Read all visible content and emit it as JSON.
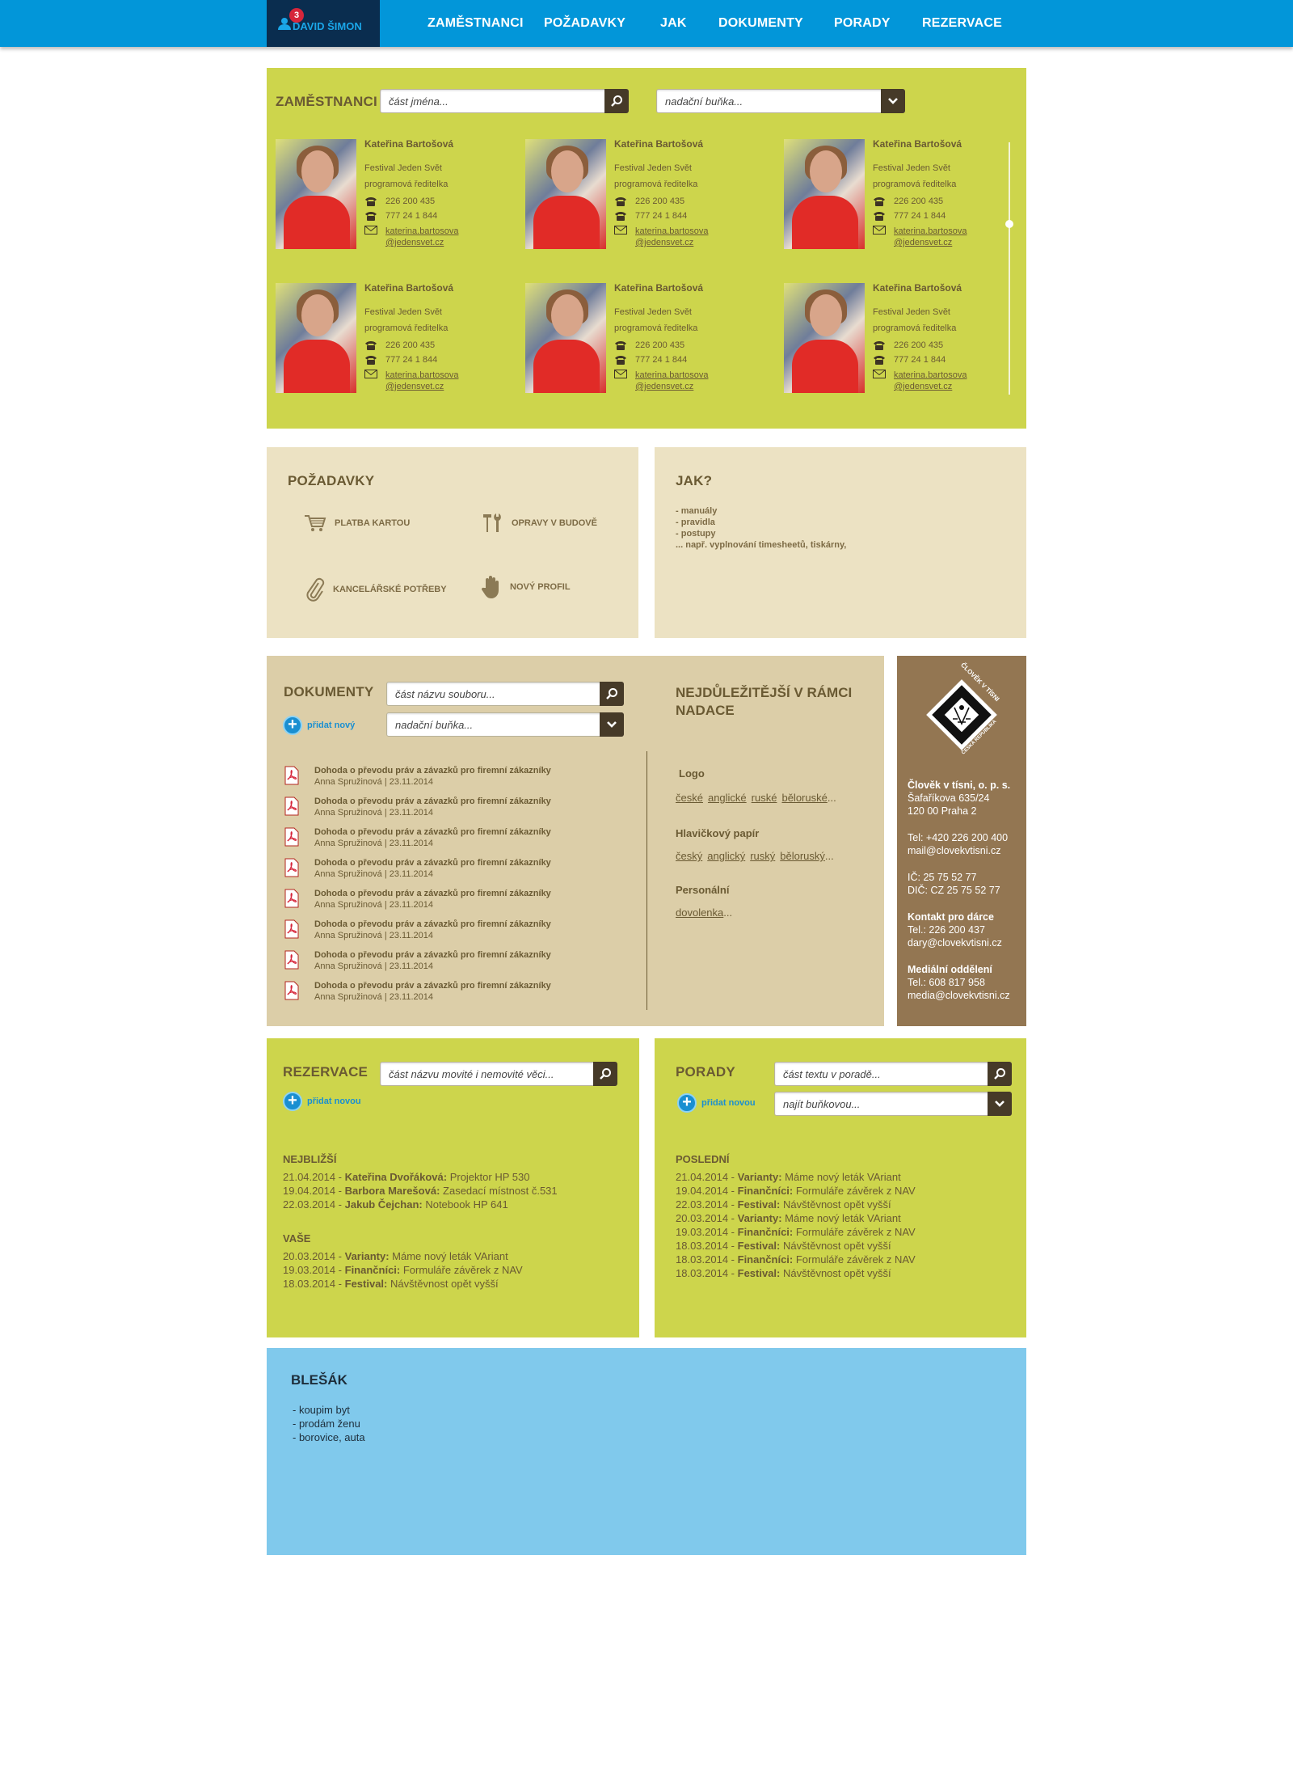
{
  "topbar": {
    "user_name": "DAVID ŠIMON",
    "notification_count": "3",
    "nav": [
      "ZAMĚSTNANCI",
      "POŽADAVKY",
      "JAK",
      "DOKUMENTY",
      "PORADY",
      "REZERVACE"
    ]
  },
  "employees": {
    "title": "ZAMĚSTNANCI",
    "search_placeholder": "část jména...",
    "filter_placeholder": "nadační buňka...",
    "cards": [
      {
        "name": "Kateřina Bartošová",
        "org": "Festival Jeden Svět",
        "role": "programová ředitelka",
        "phone1": "226 200 435",
        "phone2": "777  24 1 844",
        "email1": "katerina.bartosova",
        "email2": "@jedensvet.cz"
      },
      {
        "name": "Kateřina Bartošová",
        "org": "Festival Jeden Svět",
        "role": "programová ředitelka",
        "phone1": "226 200 435",
        "phone2": "777  24 1 844",
        "email1": "katerina.bartosova",
        "email2": "@jedensvet.cz"
      },
      {
        "name": "Kateřina Bartošová",
        "org": "Festival Jeden Svět",
        "role": "programová ředitelka",
        "phone1": "226 200 435",
        "phone2": "777  24 1 844",
        "email1": "katerina.bartosova",
        "email2": "@jedensvet.cz"
      },
      {
        "name": "Kateřina Bartošová",
        "org": "Festival Jeden Svět",
        "role": "programová ředitelka",
        "phone1": "226 200 435",
        "phone2": "777  24 1 844",
        "email1": "katerina.bartosova",
        "email2": "@jedensvet.cz"
      },
      {
        "name": "Kateřina Bartošová",
        "org": "Festival Jeden Svět",
        "role": "programová ředitelka",
        "phone1": "226 200 435",
        "phone2": "777  24 1 844",
        "email1": "katerina.bartosova",
        "email2": "@jedensvet.cz"
      },
      {
        "name": "Kateřina Bartošová",
        "org": "Festival Jeden Svět",
        "role": "programová ředitelka",
        "phone1": "226 200 435",
        "phone2": "777  24 1 844",
        "email1": "katerina.bartosova",
        "email2": "@jedensvet.cz"
      }
    ]
  },
  "requests": {
    "title": "POŽADAVKY",
    "items": [
      "PLATBA KARTOU",
      "OPRAVY V BUDOVĚ",
      "KANCELÁŘSKÉ POTŘEBY",
      "NOVÝ PROFIL"
    ]
  },
  "how": {
    "title": "JAK?",
    "lines": [
      "- manuály",
      "- pravidla",
      "- postupy",
      "... např. vyplnování timesheetů, tiskárny,"
    ]
  },
  "documents": {
    "title": "DOKUMENTY",
    "search_placeholder": "část názvu souboru...",
    "filter_placeholder": "nadační buňka...",
    "add_label": "přidat nový",
    "items": [
      {
        "title": "Dohoda o převodu práv a závazků pro firemní zákazníky",
        "meta": "Anna Spružinová | 23.11.2014"
      },
      {
        "title": "Dohoda o převodu práv a závazků pro firemní zákazníky",
        "meta": "Anna Spružinová | 23.11.2014"
      },
      {
        "title": "Dohoda o převodu práv a závazků pro firemní zákazníky",
        "meta": "Anna Spružinová | 23.11.2014"
      },
      {
        "title": "Dohoda o převodu práv a závazků pro firemní zákazníky",
        "meta": "Anna Spružinová | 23.11.2014"
      },
      {
        "title": "Dohoda o převodu práv a závazků pro firemní zákazníky",
        "meta": "Anna Spružinová | 23.11.2014"
      },
      {
        "title": "Dohoda o převodu práv a závazků pro firemní zákazníky",
        "meta": "Anna Spružinová | 23.11.2014"
      },
      {
        "title": "Dohoda o převodu práv a závazků pro firemní zákazníky",
        "meta": "Anna Spružinová | 23.11.2014"
      },
      {
        "title": "Dohoda o převodu práv a závazků pro firemní zákazníky",
        "meta": "Anna Spružinová | 23.11.2014"
      }
    ],
    "important_title_1": "NEJDŮLEŽITĚJŠÍ V RÁMCI",
    "important_title_2": "NADACE",
    "groups": [
      {
        "label": "Logo",
        "links": [
          "české",
          "anglické",
          "ruské",
          "běloruské"
        ],
        "more": "..."
      },
      {
        "label": "Hlavičkový papír",
        "links": [
          "český",
          "anglický",
          "ruský",
          "běloruský"
        ],
        "more": "..."
      },
      {
        "label": "Personální",
        "links": [
          "dovolenka"
        ],
        "more": "..."
      }
    ]
  },
  "org": {
    "logo_text_top": "ČLOVĚK V TÍSNI",
    "logo_text_bottom": "ČESKÁ REPUBLIKA",
    "name": "Člověk v tísni, o. p. s.",
    "street": "Šafaříkova 635/24",
    "city": "120 00 Praha 2",
    "tel": "Tel: +420 226 200 400",
    "mail": "mail@clovekvtisni.cz",
    "ic": "IČ: 25 75 52 77",
    "dic": "DIČ: CZ 25 75 52 77",
    "donor_title": "Kontakt pro dárce",
    "donor_tel": "Tel.: 226 200 437",
    "donor_mail": "dary@clovekvtisni.cz",
    "media_title": "Mediální oddělení",
    "media_tel": "Tel.: 608 817 958",
    "media_mail": "media@clovekvtisni.cz"
  },
  "reservations": {
    "title": "REZERVACE",
    "search_placeholder": "část názvu movité i nemovité věci...",
    "add_label": "přidat novou",
    "nearest_title": "NEJBLIŽŠÍ",
    "nearest": [
      {
        "date": "21.04.2014 - ",
        "who": "Kateřina Dvořáková:",
        "what": " Projektor HP 530"
      },
      {
        "date": "19.04.2014 - ",
        "who": "Barbora Marešová:",
        "what": " Zasedací místnost č.531"
      },
      {
        "date": "22.03.2014 - ",
        "who": "Jakub Čejchan:",
        "what": " Notebook HP 641"
      }
    ],
    "yours_title": "VAŠE",
    "yours": [
      {
        "date": "20.03.2014 - ",
        "who": "Varianty:",
        "what": " Máme nový leták VAriant"
      },
      {
        "date": "19.03.2014 - ",
        "who": "Finančníci:",
        "what": " Formuláře závěrek z NAV"
      },
      {
        "date": "18.03.2014 - ",
        "who": "Festival:",
        "what": " Návštěvnost opět vyšší"
      }
    ]
  },
  "meetings": {
    "title": "PORADY",
    "search_placeholder": "část textu v poradě...",
    "filter_placeholder": "najít buňkovou...",
    "add_label": "přidat novou",
    "last_title": "POSLEDNÍ",
    "items": [
      {
        "date": "21.04.2014 - ",
        "who": "Varianty:",
        "what": " Máme nový leták VAriant"
      },
      {
        "date": "19.04.2014 - ",
        "who": "Finančníci:",
        "what": " Formuláře závěrek z NAV"
      },
      {
        "date": "22.03.2014 - ",
        "who": "Festival:",
        "what": " Návštěvnost opět vyšší"
      },
      {
        "date": "20.03.2014 - ",
        "who": "Varianty:",
        "what": " Máme nový leták VAriant"
      },
      {
        "date": "19.03.2014 - ",
        "who": "Finančníci:",
        "what": " Formuláře závěrek z NAV"
      },
      {
        "date": "18.03.2014 - ",
        "who": "Festival:",
        "what": " Návštěvnost opět vyšší"
      },
      {
        "date": "18.03.2014 - ",
        "who": "Finančníci:",
        "what": " Formuláře závěrek z NAV"
      },
      {
        "date": "18.03.2014 - ",
        "who": "Festival:",
        "what": " Návštěvnost opět vyšší"
      }
    ]
  },
  "bazaar": {
    "title": "BLEŠÁK",
    "lines": [
      "- koupim byt",
      "- prodám ženu",
      "- borovice, auta"
    ]
  }
}
